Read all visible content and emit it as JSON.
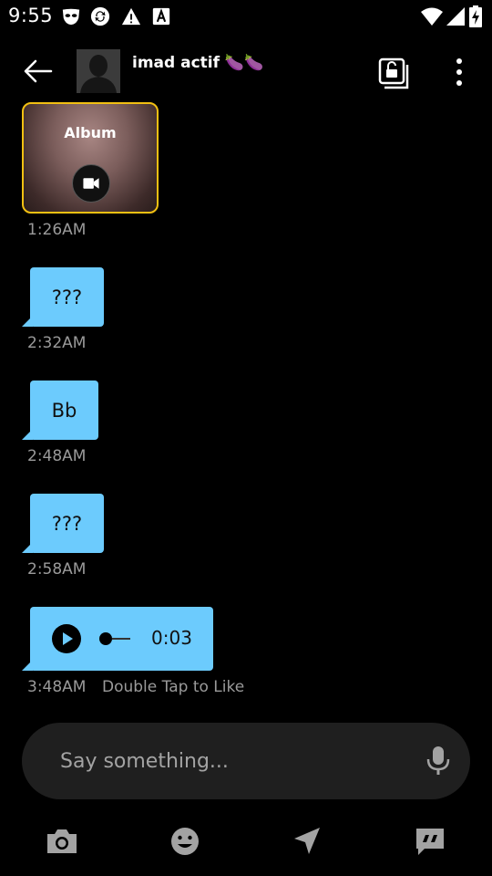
{
  "status_bar": {
    "time": "9:55",
    "icons": [
      "grindr-mask-icon",
      "sync-icon",
      "warning-icon",
      "font-a-icon",
      "wifi-icon",
      "signal-icon",
      "battery-charging-icon"
    ]
  },
  "header": {
    "contact_name": "imad actif 🍆🍆",
    "back_icon": "arrow-left-icon",
    "album_icon": "unlock-albums-icon",
    "more_icon": "more-vert-icon"
  },
  "messages": [
    {
      "type": "album",
      "label": "Album",
      "time": "1:26AM",
      "icon": "videocam-icon",
      "border_color": "#f2c012"
    },
    {
      "type": "text",
      "text": "???",
      "time": "2:32AM"
    },
    {
      "type": "text",
      "text": "Bb",
      "time": "2:48AM"
    },
    {
      "type": "text",
      "text": "???",
      "time": "2:58AM"
    },
    {
      "type": "voice",
      "duration": "0:03",
      "time": "3:48AM",
      "hint": "Double Tap to Like"
    }
  ],
  "composer": {
    "placeholder": "Say something...",
    "mic_icon": "mic-icon"
  },
  "toolbar": {
    "items": [
      "camera-icon",
      "emoji-icon",
      "location-icon",
      "saved-phrases-icon"
    ]
  },
  "colors": {
    "bubble": "#6ccbfd",
    "background": "#000000",
    "composer": "#1f1f1f",
    "timestamp": "#9a9a9a",
    "album_border": "#f2c012"
  }
}
